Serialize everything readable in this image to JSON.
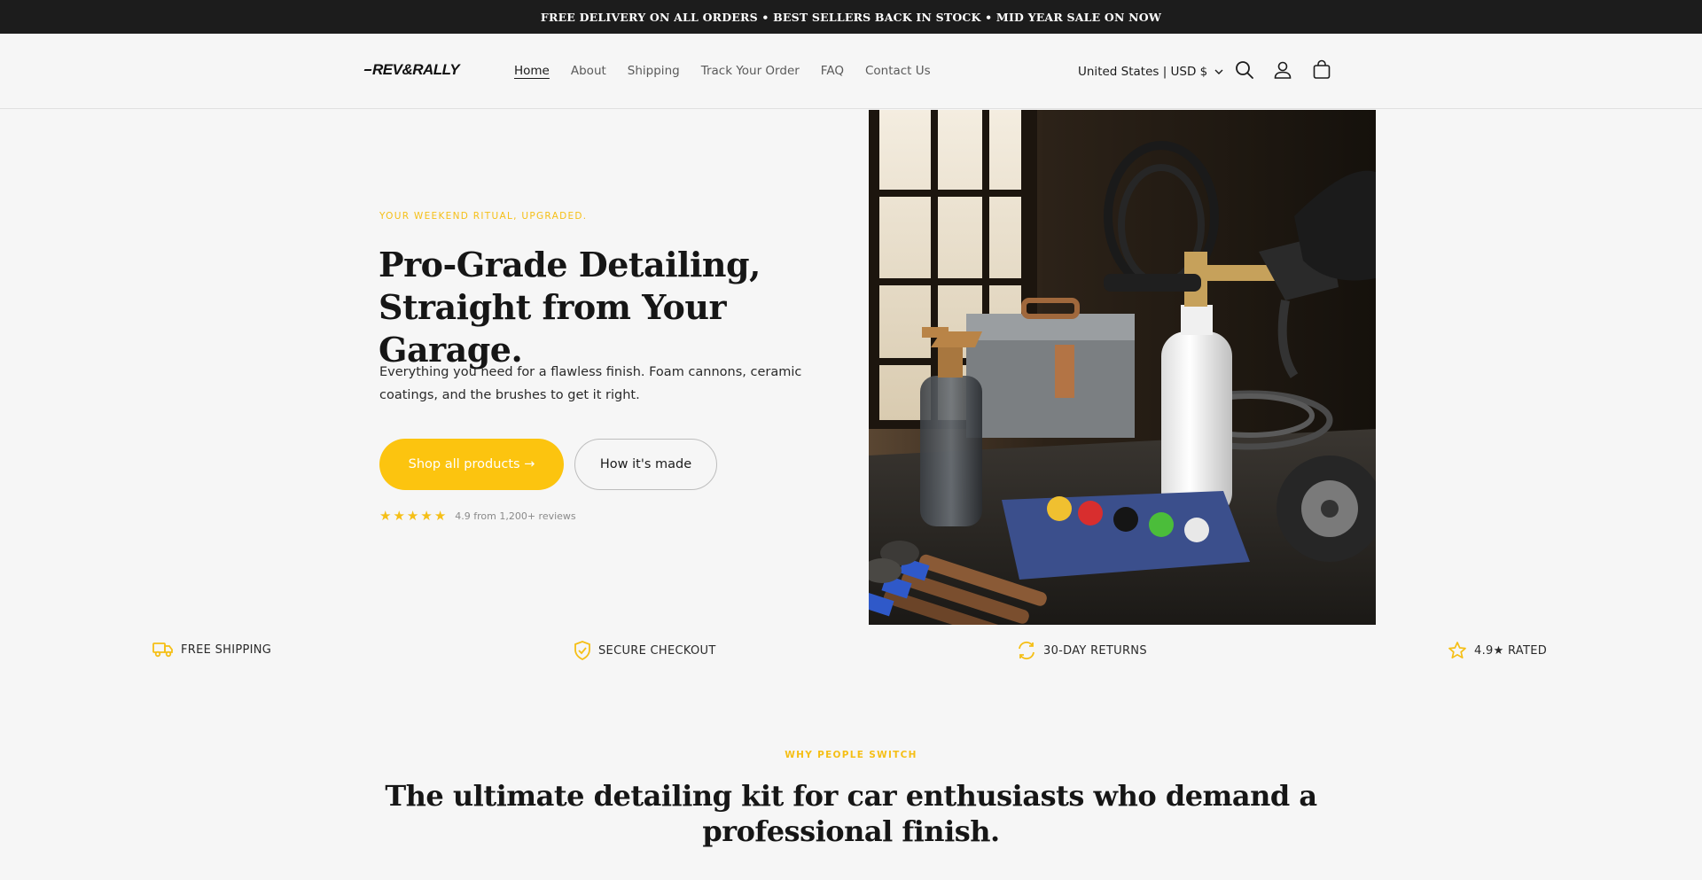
{
  "announcement": "FREE DELIVERY ON ALL ORDERS • BEST SELLERS BACK IN STOCK • MID YEAR SALE ON NOW",
  "header": {
    "logo": "REV&RALLY",
    "nav": [
      "Home",
      "About",
      "Shipping",
      "Track Your Order",
      "FAQ",
      "Contact Us"
    ],
    "active_nav": "Home",
    "region": "United States | USD $",
    "icons": [
      "search-icon",
      "account-icon",
      "cart-icon"
    ]
  },
  "hero": {
    "eyebrow": "YOUR WEEKEND RITUAL, UPGRADED.",
    "headline_line1": "Pro-Grade Detailing,",
    "headline_line2": "Straight from Your Garage.",
    "lede": "Everything you need for a flawless finish. Foam cannons, ceramic coatings, and the brushes to get it right.",
    "primary_cta": "Shop all products →",
    "secondary_cta": "How it's made",
    "rating_stars": 5,
    "rating_text": "4.9 from 1,200+ reviews"
  },
  "trust": [
    {
      "icon": "truck-icon",
      "label": "FREE SHIPPING"
    },
    {
      "icon": "shield-check-icon",
      "label": "SECURE CHECKOUT"
    },
    {
      "icon": "refresh-icon",
      "label": "30-DAY RETURNS"
    },
    {
      "icon": "star-icon",
      "label": "4.9★ RATED"
    }
  ],
  "why": {
    "eyebrow": "WHY PEOPLE SWITCH",
    "title": "The ultimate detailing kit for car enthusiasts who demand a professional finish."
  },
  "colors": {
    "accent": "#fcc40f",
    "announcement_bg": "#1c1c1c",
    "page_bg": "#f6f6f6"
  }
}
